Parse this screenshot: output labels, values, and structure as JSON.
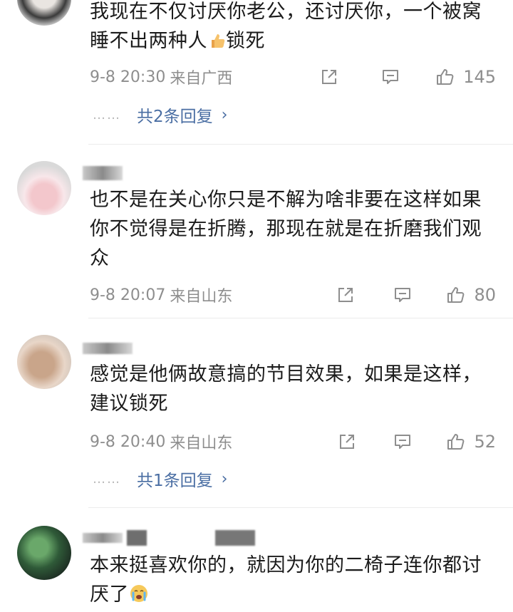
{
  "comments": [
    {
      "text": "我现在不仅讨厌你老公，还讨厌你，一个被窝睡不出两种人",
      "text_after_emoji": "锁死",
      "emoji": "thumbs-up-emoji",
      "time": "9-8 20:30",
      "location": "来自广西",
      "likes": "145",
      "reply_dots": "……",
      "replies": "共2条回复"
    },
    {
      "text": "也不是在关心你只是不解为啥非要在这样如果你不觉得是在折腾，那现在就是在折磨我们观众",
      "time": "9-8 20:07",
      "location": "来自山东",
      "likes": "80"
    },
    {
      "text": "感觉是他俩故意搞的节目效果，如果是这样，建议锁死",
      "time": "9-8 20:40",
      "location": "来自山东",
      "likes": "52",
      "reply_dots": "……",
      "replies": "共1条回复"
    },
    {
      "text": "本来挺喜欢你的，就因为你的二椅子连你都讨厌了",
      "emoji": "crying-face-emoji"
    }
  ],
  "icons": {
    "share": "share-icon",
    "comment": "comment-icon",
    "like": "thumbs-up-icon",
    "chevron": "chevron-right-icon"
  },
  "colors": {
    "link": "#4a6ea3",
    "meta": "#8e8e8e",
    "divider": "#ececec"
  }
}
